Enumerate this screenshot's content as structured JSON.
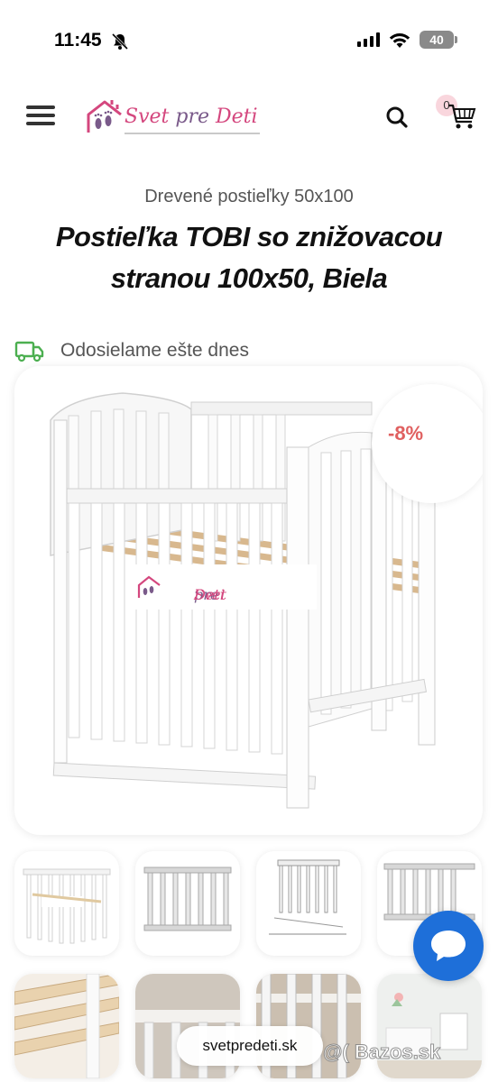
{
  "status_bar": {
    "time": "11:45",
    "battery": "40"
  },
  "header": {
    "logo": {
      "part1": "Svet ",
      "part2": "pre ",
      "part3": "Deti"
    },
    "cart_count": "0"
  },
  "product": {
    "category": "Drevené postieľky 50x100",
    "title_line1": "Postieľka TOBI so znižovacou",
    "title_line2": "stranou 100x50, Biela",
    "shipping": "Odosielame ešte dnes",
    "discount": "-8%"
  },
  "overlay_logo": {
    "part1": "Svet ",
    "part2": "pre ",
    "part3": "Deti"
  },
  "thumbnails": [
    {
      "alt": "crib-white-logo"
    },
    {
      "alt": "crib-white-front"
    },
    {
      "alt": "crib-dimensions"
    },
    {
      "alt": "crib-white-side"
    },
    {
      "alt": "slats-detail"
    },
    {
      "alt": "rail-detail"
    },
    {
      "alt": "bars-detail"
    },
    {
      "alt": "nursery-room"
    }
  ],
  "footer": {
    "url": "svetpredeti.sk",
    "watermark": "@( Bazos.sk"
  },
  "colors": {
    "accent_pink": "#d4477e",
    "chat_blue": "#1e6fd9",
    "discount_red": "#e06060",
    "truck_green": "#4caf50"
  }
}
